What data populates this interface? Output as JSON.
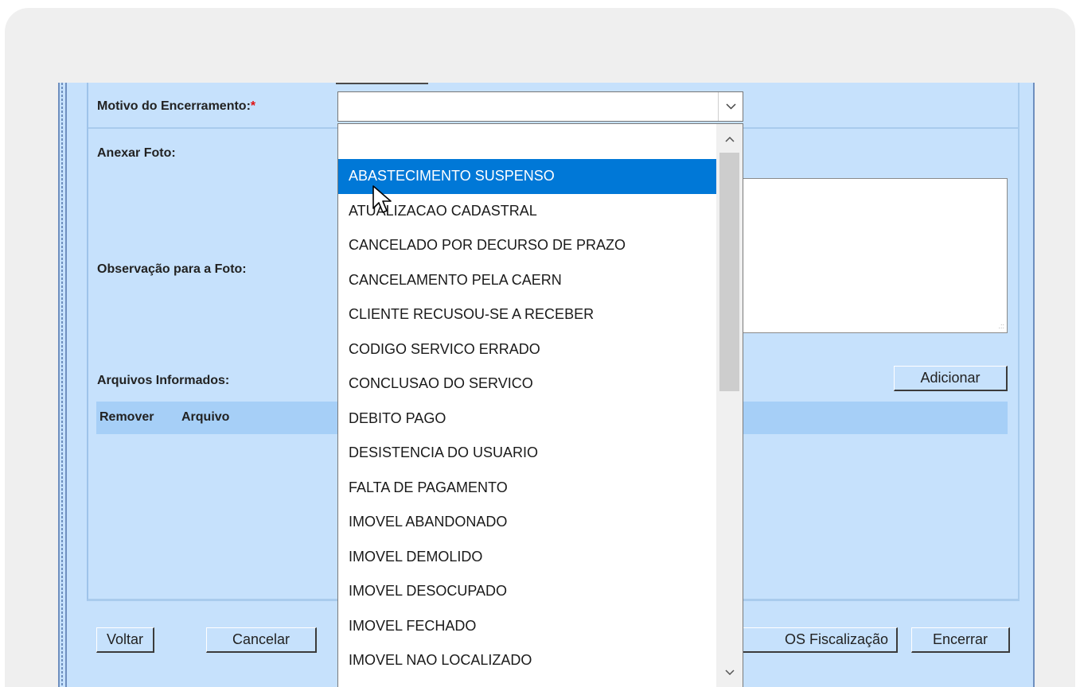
{
  "form": {
    "motivo_label": "Motivo do Encerramento:",
    "required_mark": "*",
    "anexar_label": "Anexar Foto:",
    "observacao_label": "Observação para a Foto:",
    "arquivos_label": "Arquivos Informados:",
    "adicionar_button": "Adicionar",
    "table_headers": [
      "Remover",
      "Arquivo"
    ],
    "motivo_selected_value": ""
  },
  "dropdown": {
    "selected_index": 1,
    "options": [
      "",
      "ABASTECIMENTO SUSPENSO",
      "ATUALIZACAO CADASTRAL",
      "CANCELADO POR DECURSO DE PRAZO",
      "CANCELAMENTO PELA CAERN",
      "CLIENTE RECUSOU-SE A RECEBER",
      "CODIGO SERVICO ERRADO",
      "CONCLUSAO DO SERVICO",
      "DEBITO PAGO",
      "DESISTENCIA DO USUARIO",
      "FALTA DE PAGAMENTO",
      "IMOVEL ABANDONADO",
      "IMOVEL DEMOLIDO",
      "IMOVEL DESOCUPADO",
      "IMOVEL FECHADO",
      "IMOVEL NAO LOCALIZADO"
    ]
  },
  "actions": {
    "voltar": "Voltar",
    "cancelar": "Cancelar",
    "os_fiscalizacao": "OS Fiscalização",
    "encerrar": "Encerrar"
  },
  "colors": {
    "panel_bg": "#c6e1fc",
    "header_bg": "#a6cff7",
    "selection": "#0078d7",
    "required": "#e01010"
  },
  "icons": {
    "select_arrow": "chevron-down-icon",
    "scroll_up": "chevron-up-icon",
    "scroll_down": "chevron-down-icon",
    "cursor": "mouse-pointer-icon"
  }
}
